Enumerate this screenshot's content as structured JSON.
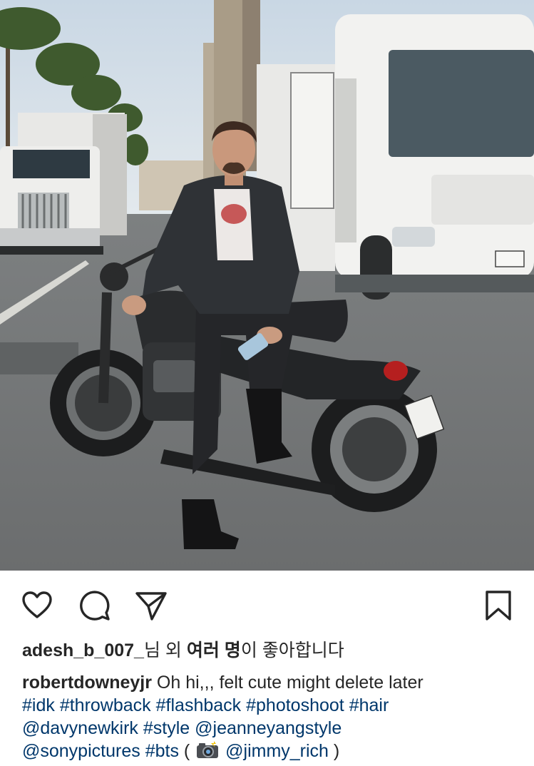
{
  "post": {
    "image_alt": "Man in dark jacket sitting on a black motorcycle parked in a studio lot next to a white RV trailer and a semi truck",
    "colors": {
      "link": "#00376b",
      "text": "#262626",
      "background": "#ffffff"
    }
  },
  "actions": {
    "like_icon": "heart-icon",
    "comment_icon": "comment-icon",
    "share_icon": "paper-plane-icon",
    "save_icon": "bookmark-icon"
  },
  "likes": {
    "username": "adesh_b_007_",
    "mid": "님 외 ",
    "others": "여러 명",
    "end": "이 좋아합니다"
  },
  "caption": {
    "author": "robertdowneyjr",
    "text": " Oh hi,,, felt cute might delete later",
    "line2": [
      "#idk",
      "#throwback",
      "#flashback",
      "#photoshoot",
      "#hair"
    ],
    "line3": [
      "@davynewkirk",
      "#style",
      "@jeanneyangstyle"
    ],
    "line4_a": "@sonypictures",
    "line4_b": "#bts",
    "line4_open": "( ",
    "line4_emoji": "camera-flash-emoji",
    "line4_mention": "@jimmy_rich",
    "line4_close": " )"
  }
}
